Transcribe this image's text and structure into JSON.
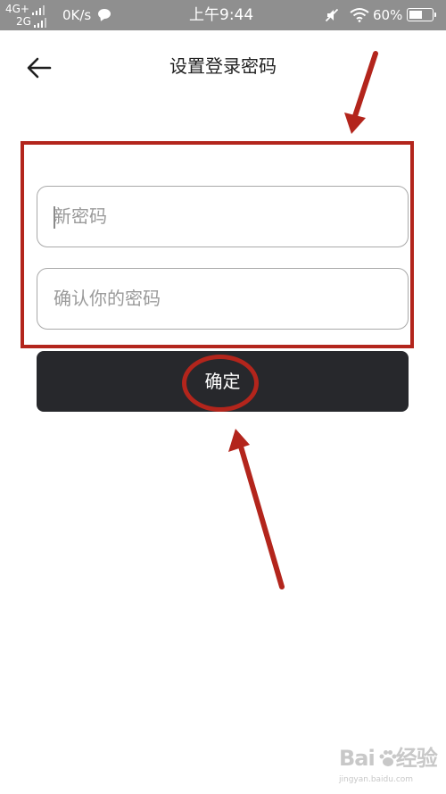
{
  "status_bar": {
    "network_top": "4G+",
    "network_bottom": "2G",
    "speed": "0K/s",
    "time": "上午9:44",
    "battery": "60%",
    "battery_level": 0.6
  },
  "header": {
    "back_icon": "arrow-left-icon",
    "title": "设置登录密码"
  },
  "form": {
    "new_password_placeholder": "新密码",
    "confirm_password_placeholder": "确认你的密码",
    "submit_label": "确定"
  },
  "annotations": {
    "color": "#b3251c"
  },
  "watermark": {
    "brand_left": "Bai",
    "brand_right": "经验",
    "url": "jingyan.baidu.com"
  }
}
